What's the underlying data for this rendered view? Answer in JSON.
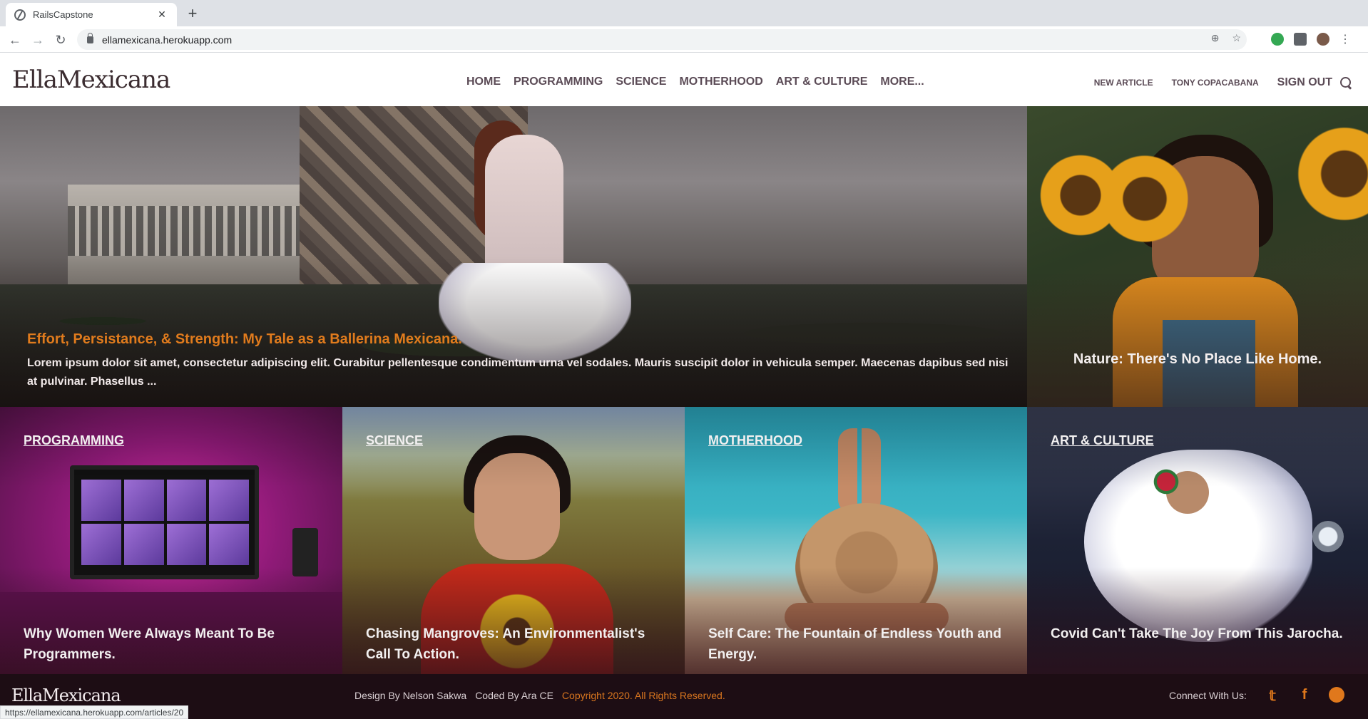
{
  "browser": {
    "tab_title": "RailsCapstone",
    "tab_close": "✕",
    "new_tab": "+",
    "url": "ellamexicana.herokuapp.com",
    "status_url": "https://ellamexicana.herokuapp.com/articles/20"
  },
  "header": {
    "logo": "EllaMexicana",
    "nav": [
      "HOME",
      "PROGRAMMING",
      "SCIENCE",
      "MOTHERHOOD",
      "ART & CULTURE",
      "MORE..."
    ],
    "new_article": "NEW ARTICLE",
    "user": "TONY COPACABANA",
    "sign_out": "SIGN OUT"
  },
  "hero": {
    "title": "Effort, Persistance, & Strength: My Tale as a Ballerina Mexicana.",
    "excerpt": "Lorem ipsum dolor sit amet, consectetur adipiscing elit. Curabitur pellentesque condimentum urna vel sodales. Mauris suscipit dolor in vehicula semper. Maecenas dapibus sed nisi at pulvinar. Phasellus ..."
  },
  "side": {
    "title": "Nature: There's No Place Like Home."
  },
  "categories": [
    {
      "label": "PROGRAMMING",
      "title": "Why Women Were Always Meant To Be Programmers."
    },
    {
      "label": "SCIENCE",
      "title": "Chasing Mangroves: An Environmentalist's Call To Action."
    },
    {
      "label": "MOTHERHOOD",
      "title": "Self Care: The Fountain of Endless Youth and Energy."
    },
    {
      "label": "ART & CULTURE",
      "title": "Covid Can't Take The Joy From This Jarocha."
    }
  ],
  "footer": {
    "logo": "EllaMexicana",
    "design": "Design By Nelson Sakwa",
    "coded": "Coded By Ara CE",
    "copyright": "Copyright 2020. All Rights Reserved.",
    "connect": "Connect With Us:"
  },
  "colors": {
    "accent": "#e07b1d",
    "footer_bg": "#1d0d14",
    "nav_text": "#5b4b56"
  }
}
